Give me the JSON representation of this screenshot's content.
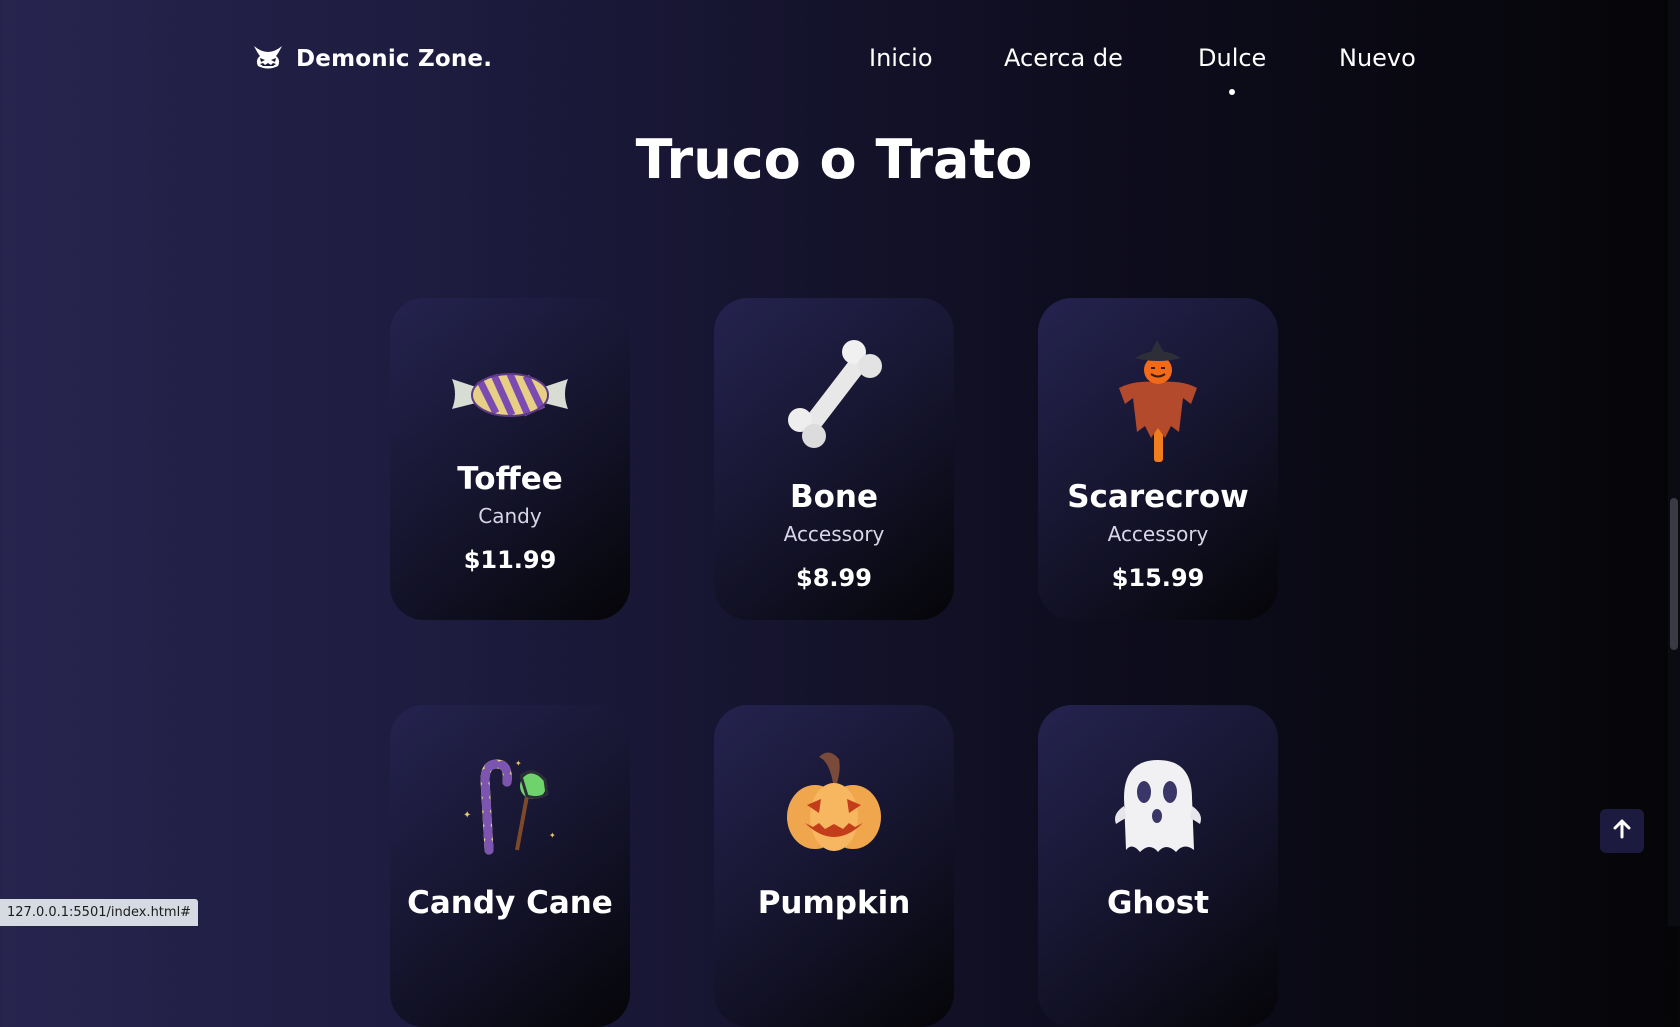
{
  "header": {
    "brand": "Demonic Zone.",
    "nav": [
      {
        "label": "Inicio"
      },
      {
        "label": "Acerca de"
      },
      {
        "label": "Dulce"
      },
      {
        "label": "Nuevo"
      }
    ],
    "active_nav": "Dulce"
  },
  "section": {
    "title": "Truco o Trato",
    "products": [
      {
        "name": "Toffee",
        "category": "Candy",
        "price": "$11.99",
        "icon": "toffee-icon"
      },
      {
        "name": "Bone",
        "category": "Accessory",
        "price": "$8.99",
        "icon": "bone-icon"
      },
      {
        "name": "Scarecrow",
        "category": "Accessory",
        "price": "$15.99",
        "icon": "scarecrow-icon"
      },
      {
        "name": "Candy Cane",
        "icon": "candy-cane-icon"
      },
      {
        "name": "Pumpkin",
        "icon": "pumpkin-icon"
      },
      {
        "name": "Ghost",
        "icon": "ghost-icon"
      }
    ]
  },
  "scroll_top_icon": "arrow-up-icon",
  "status_bar": {
    "url": "127.0.0.1:5501/index.html#"
  },
  "colors": {
    "background_start": "#27244f",
    "background_end": "#050508",
    "card": "#1c1a3e",
    "text": "#ffffff"
  }
}
